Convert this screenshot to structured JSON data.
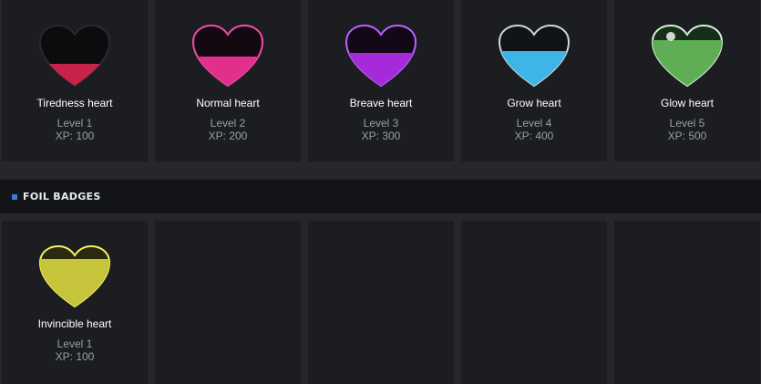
{
  "hearts": [
    {
      "name": "Tiredness heart",
      "level": "Level 1",
      "xp": "XP: 100",
      "icon": "heart-black-icon",
      "liquid": "#c8244a",
      "glow": "#000000"
    },
    {
      "name": "Normal heart",
      "level": "Level 2",
      "xp": "XP: 200",
      "icon": "heart-pink-icon",
      "liquid": "#e0308a",
      "glow": "#ff4fb0"
    },
    {
      "name": "Breave heart",
      "level": "Level 3",
      "xp": "XP: 300",
      "icon": "heart-purple-icon",
      "liquid": "#a52ad8",
      "glow": "#c060ff"
    },
    {
      "name": "Grow heart",
      "level": "Level 4",
      "xp": "XP: 400",
      "icon": "heart-blue-icon",
      "liquid": "#3fb4e6",
      "glow": "#7fd8ff"
    },
    {
      "name": "Glow heart",
      "level": "Level 5",
      "xp": "XP: 500",
      "icon": "heart-green-icon",
      "liquid": "#5fae56",
      "glow": "#a8ffb0"
    }
  ],
  "foil_section": {
    "title": "FOIL BADGES",
    "items": [
      {
        "name": "Invincible heart",
        "level": "Level 1",
        "xp": "XP: 100",
        "icon": "heart-gold-icon",
        "liquid": "#c6c43a",
        "glow": "#e8f050"
      }
    ]
  }
}
